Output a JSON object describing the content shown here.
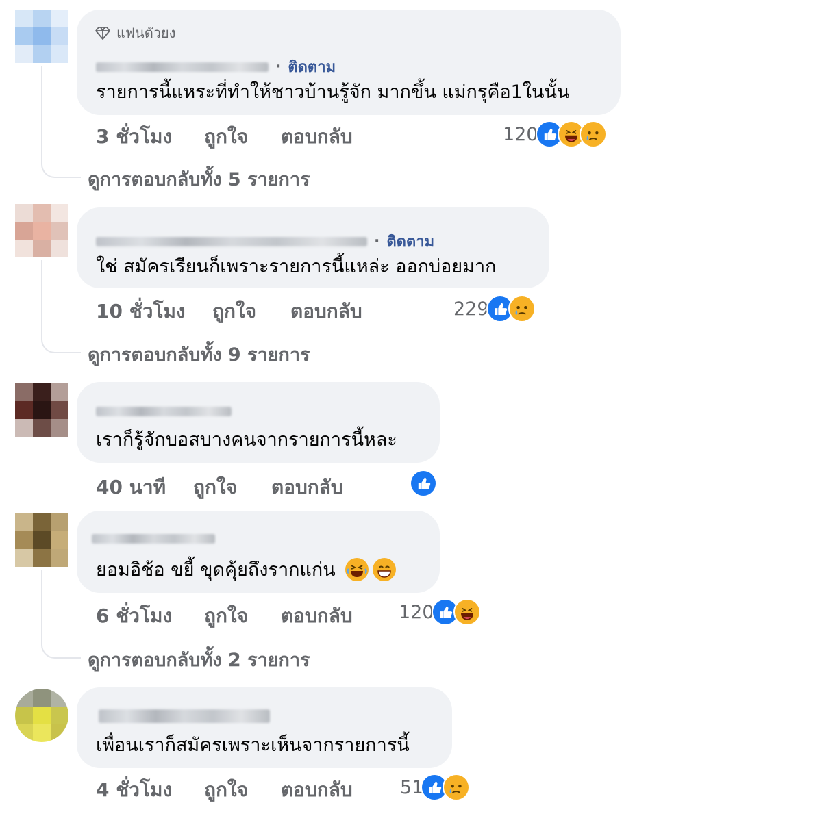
{
  "labels": {
    "like": "ถูกใจ",
    "reply": "ตอบกลับ",
    "follow": "ติดตาม",
    "dot": "·"
  },
  "comments": [
    {
      "badge": "แฟนตัวยง",
      "text": "รายการนี้แหระที่ทำให้ชาวบ้านรู้จัก มากขึ้น แม่กรุคือ1ในนั้น",
      "time": "3 ชั่วโมง",
      "reaction_count": "120",
      "reactions": [
        "like-icon",
        "haha-icon",
        "sad-icon"
      ],
      "view_replies": "ดูการตอบกลับทั้ง 5 รายการ",
      "avatar_colors": [
        "#d7e7f7",
        "#b8d4f2",
        "#e4eefa",
        "#a9cbf0",
        "#8fbaec",
        "#c7dcf5",
        "#e2ecf8",
        "#b2d0f1",
        "#dae8f8"
      ]
    },
    {
      "text": "ใช่ สมัครเรียนก็เพราะรายการนี้แหล่ะ ออกบ่อยมาก",
      "time": "10 ชั่วโมง",
      "reaction_count": "229",
      "reactions": [
        "like-icon",
        "sad-icon"
      ],
      "view_replies": "ดูการตอบกลับทั้ง 9 รายการ",
      "avatar_colors": [
        "#ecdcd6",
        "#e3bdb0",
        "#f3e6e1",
        "#d8a596",
        "#e9b3a2",
        "#e0c2b8",
        "#f1e2dc",
        "#d9b0a3",
        "#efe1dc"
      ]
    },
    {
      "text": "เราก็รู้จักบอสบางคนจากรายการนี้หละ",
      "time": "40 นาที",
      "reaction_count": "",
      "reactions": [
        "like-icon"
      ],
      "avatar_colors": [
        "#8a6c66",
        "#3a1f1c",
        "#b39e98",
        "#5c2a24",
        "#2a1513",
        "#704a44",
        "#cbbab5",
        "#6d4d47",
        "#a58e88"
      ]
    },
    {
      "text": "ยอมอิช้อ ขยี้ ขุดคุ้ยถึงรากแก่น",
      "text_emojis": [
        "rofl-emoji",
        "grin-emoji"
      ],
      "time": "6 ชั่วโมง",
      "reaction_count": "120",
      "reactions": [
        "like-icon",
        "haha-icon"
      ],
      "view_replies": "ดูการตอบกลับทั้ง 2 รายการ",
      "avatar_colors": [
        "#c9b58a",
        "#7a6438",
        "#b7a070",
        "#a58b57",
        "#5c4a26",
        "#c6ad78",
        "#d7c8a5",
        "#8c7444",
        "#bfa877"
      ]
    },
    {
      "text": "เพื่อนเราก็สมัครเพราะเห็นจากรายการนี้",
      "time": "4 ชั่วโมง",
      "reaction_count": "51",
      "reactions": [
        "like-icon",
        "sad-icon"
      ],
      "avatar_colors": [
        "#a8ab9a",
        "#8f937d",
        "#b0b3a4",
        "#c7c44a",
        "#e4e044",
        "#c9c64e",
        "#d9d454",
        "#ebe65c",
        "#c8c24b"
      ]
    }
  ]
}
